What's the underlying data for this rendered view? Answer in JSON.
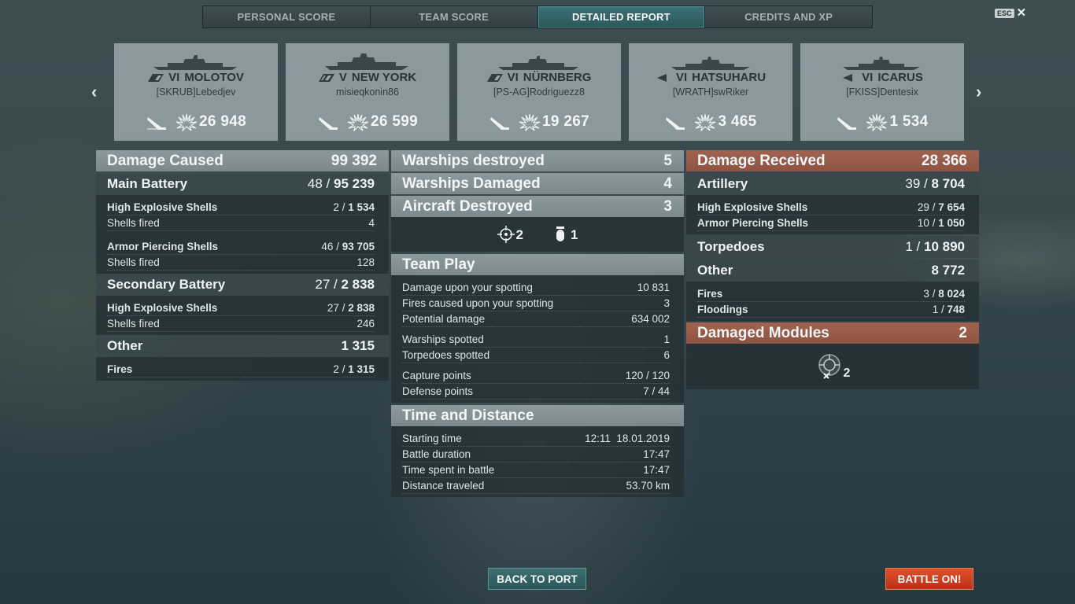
{
  "tabs": [
    {
      "label": "PERSONAL SCORE"
    },
    {
      "label": "TEAM SCORE"
    },
    {
      "label": "DETAILED REPORT",
      "active": true
    },
    {
      "label": "CREDITS AND XP"
    }
  ],
  "esc": {
    "key": "ESC",
    "close": "✕"
  },
  "nav": {
    "prev": "‹",
    "next": "›"
  },
  "ships": [
    {
      "tier": "VI",
      "name": "MOLOTOV",
      "player": "[SKRUB]Lebedjev",
      "damage": "26 948",
      "class": "cruiser"
    },
    {
      "tier": "V",
      "name": "NEW YORK",
      "player": "misieqkonin86",
      "damage": "26 599",
      "class": "battleship"
    },
    {
      "tier": "VI",
      "name": "NÜRNBERG",
      "player": "[PS-AG]Rodriguezz8",
      "damage": "19 267",
      "class": "cruiser"
    },
    {
      "tier": "VI",
      "name": "HATSUHARU",
      "player": "[WRATH]swRiker",
      "damage": "3 465",
      "class": "destroyer"
    },
    {
      "tier": "VI",
      "name": "ICARUS",
      "player": "[FKISS]Dentesix",
      "damage": "1 534",
      "class": "destroyer"
    }
  ],
  "damage_caused": {
    "title": "Damage Caused",
    "value": "99 392",
    "main_battery": {
      "title": "Main Battery",
      "hits": "48",
      "sep": " / ",
      "damage": "95 239",
      "he": {
        "label": "High Explosive Shells",
        "hits": "2",
        "damage": "1 534"
      },
      "he_fired": {
        "label": "Shells fired",
        "value": "4"
      },
      "ap": {
        "label": "Armor Piercing Shells",
        "hits": "46",
        "damage": "93 705"
      },
      "ap_fired": {
        "label": "Shells fired",
        "value": "128"
      }
    },
    "secondary": {
      "title": "Secondary Battery",
      "hits": "27",
      "damage": "2 838",
      "he": {
        "label": "High Explosive Shells",
        "hits": "27",
        "damage": "2 838"
      },
      "he_fired": {
        "label": "Shells fired",
        "value": "246"
      }
    },
    "other": {
      "title": "Other",
      "value": "1 315",
      "fires": {
        "label": "Fires",
        "hits": "2",
        "damage": "1 315"
      }
    }
  },
  "middle": {
    "destroyed": {
      "label": "Warships destroyed",
      "value": "5"
    },
    "damaged": {
      "label": "Warships Damaged",
      "value": "4"
    },
    "aircraft": {
      "label": "Aircraft Destroyed",
      "value": "3"
    },
    "aircraft_icons": {
      "fighter": "2",
      "bomber": "1"
    },
    "team_play": {
      "title": "Team Play",
      "rows": [
        {
          "label": "Damage upon your spotting",
          "value": "10 831"
        },
        {
          "label": "Fires caused upon your spotting",
          "value": "3"
        },
        {
          "label": "Potential damage",
          "value": "634 002"
        },
        {
          "label": "Warships spotted",
          "value": "1"
        },
        {
          "label": "Torpedoes spotted",
          "value": "6"
        },
        {
          "label": "Capture points",
          "value": "120 / 120"
        },
        {
          "label": "Defense points",
          "value": "7 / 44"
        }
      ]
    },
    "time": {
      "title": "Time and Distance",
      "rows": [
        {
          "label": "Starting time",
          "value": "12:11  18.01.2019"
        },
        {
          "label": "Battle duration",
          "value": "17:47"
        },
        {
          "label": "Time spent in battle",
          "value": "17:47"
        },
        {
          "label": "Distance traveled",
          "value": "53.70 km"
        }
      ]
    }
  },
  "damage_received": {
    "title": "Damage Received",
    "value": "28 366",
    "artillery": {
      "title": "Artillery",
      "hits": "39",
      "damage": "8 704",
      "he": {
        "label": "High Explosive Shells",
        "hits": "29",
        "damage": "7 654"
      },
      "ap": {
        "label": "Armor Piercing Shells",
        "hits": "10",
        "damage": "1 050"
      }
    },
    "torpedoes": {
      "title": "Torpedoes",
      "hits": "1",
      "damage": "10 890"
    },
    "other": {
      "title": "Other",
      "value": "8 772",
      "fires": {
        "label": "Fires",
        "hits": "3",
        "damage": "8 024"
      },
      "floodings": {
        "label": "Floodings",
        "hits": "1",
        "damage": "748"
      }
    },
    "modules": {
      "title": "Damaged Modules",
      "value": "2",
      "icon_count": "2"
    }
  },
  "buttons": {
    "back": "BACK TO PORT",
    "battle": "BATTLE ON!"
  },
  "colors": {
    "accent_teal": "#2b5659",
    "received_orange": "#8d5442",
    "battle_red": "#c23a1e"
  }
}
